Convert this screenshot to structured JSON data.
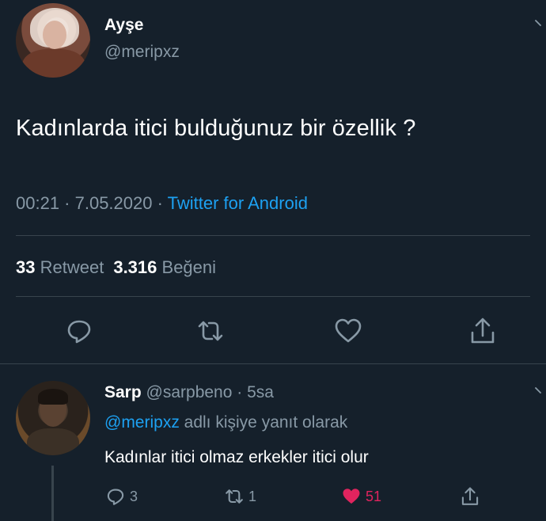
{
  "tweet": {
    "author_name": "Ayşe",
    "author_handle": "@meripxz",
    "text": "Kadınlarda itici bulduğunuz bir özellik ?",
    "time": "00:21 · 7.05.2020 · ",
    "source": "Twitter for Android",
    "retweet_count": "33",
    "retweet_label": "Retweet",
    "like_count": "3.316",
    "like_label": "Beğeni",
    "actions": [
      "reply-icon",
      "retweet-icon",
      "like-icon",
      "share-icon"
    ]
  },
  "reply": {
    "author_name": "Sarp",
    "author_handle": "@sarpbeno",
    "time": " · 5sa",
    "replying_mention": "@meripxz",
    "replying_suffix": " adlı kişiye yanıt olarak",
    "text": "Kadınlar itici olmaz erkekler itici olur",
    "reply_count": "3",
    "retweet_count": "1",
    "like_count": "51",
    "liked": true
  },
  "colors": {
    "background": "#15202b",
    "secondary_text": "#8899a6",
    "link": "#1da1f2",
    "like": "#e0245e",
    "divider": "#38444d"
  }
}
